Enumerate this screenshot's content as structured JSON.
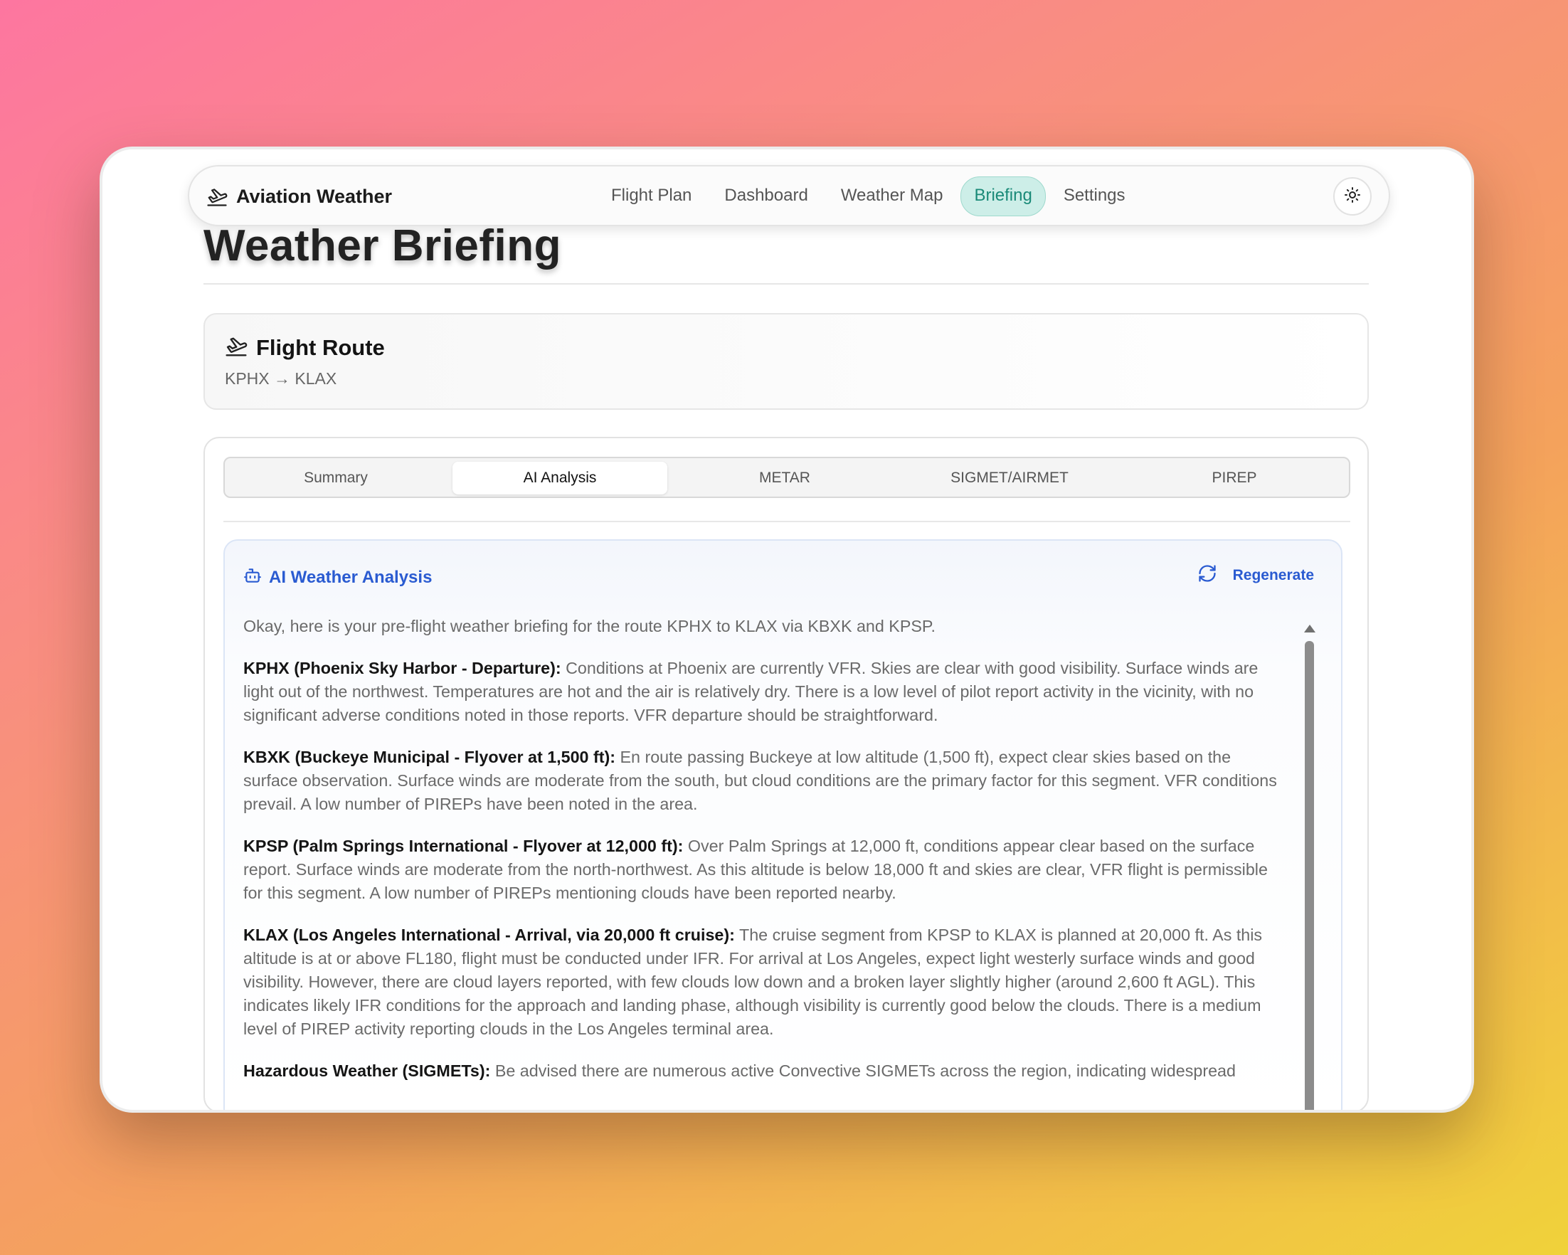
{
  "app": {
    "brand": "Aviation Weather"
  },
  "nav": {
    "links": [
      "Flight Plan",
      "Dashboard",
      "Weather Map",
      "Briefing",
      "Settings"
    ],
    "active": "Briefing"
  },
  "theme_toggle": {
    "icon": "sun-icon"
  },
  "page": {
    "title": "Weather Briefing"
  },
  "route_card": {
    "title": "Flight Route",
    "route": "KPHX → KLAX",
    "icon": "plane-departure-icon"
  },
  "tabs": {
    "items": [
      "Summary",
      "AI Analysis",
      "METAR",
      "SIGMET/AIRMET",
      "PIREP"
    ],
    "active": "AI Analysis"
  },
  "analysis": {
    "title": "AI Weather Analysis",
    "icon": "robot-icon",
    "regenerate_label": "Regenerate",
    "regenerate_icon": "refresh-icon",
    "intro": "Okay, here is your pre-flight weather briefing for the route KPHX to KLAX via KBXK and KPSP.",
    "sections": [
      {
        "heading": "KPHX (Phoenix Sky Harbor - Departure):",
        "text": " Conditions at Phoenix are currently VFR. Skies are clear with good visibility. Surface winds are light out of the northwest. Temperatures are hot and the air is relatively dry. There is a low level of pilot report activity in the vicinity, with no significant adverse conditions noted in those reports. VFR departure should be straightforward."
      },
      {
        "heading": "KBXK (Buckeye Municipal - Flyover at 1,500 ft):",
        "text": " En route passing Buckeye at low altitude (1,500 ft), expect clear skies based on the surface observation. Surface winds are moderate from the south, but cloud conditions are the primary factor for this segment. VFR conditions prevail. A low number of PIREPs have been noted in the area."
      },
      {
        "heading": "KPSP (Palm Springs International - Flyover at 12,000 ft):",
        "text": " Over Palm Springs at 12,000 ft, conditions appear clear based on the surface report. Surface winds are moderate from the north-northwest. As this altitude is below 18,000 ft and skies are clear, VFR flight is permissible for this segment. A low number of PIREPs mentioning clouds have been reported nearby."
      },
      {
        "heading": "KLAX (Los Angeles International - Arrival, via 20,000 ft cruise):",
        "text": " The cruise segment from KPSP to KLAX is planned at 20,000 ft. As this altitude is at or above FL180, flight must be conducted under IFR. For arrival at Los Angeles, expect light westerly surface winds and good visibility. However, there are cloud layers reported, with few clouds low down and a broken layer slightly higher (around 2,600 ft AGL). This indicates likely IFR conditions for the approach and landing phase, although visibility is currently good below the clouds. There is a medium level of PIREP activity reporting clouds in the Los Angeles terminal area."
      },
      {
        "heading": "Hazardous Weather (SIGMETs):",
        "text": " Be advised there are numerous active Convective SIGMETs across the region, indicating widespread"
      }
    ]
  },
  "colors": {
    "accent_teal": "#1a8a78",
    "accent_blue": "#2a5bd1"
  }
}
